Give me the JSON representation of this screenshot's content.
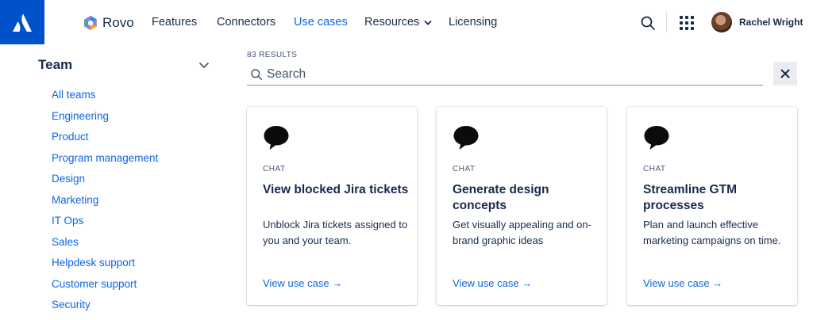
{
  "header": {
    "product_name": "Rovo",
    "nav": [
      {
        "label": "Features"
      },
      {
        "label": "Connectors"
      },
      {
        "label": "Use cases",
        "active": true
      },
      {
        "label": "Resources",
        "has_dropdown": true
      },
      {
        "label": "Licensing"
      }
    ],
    "user_name": "Rachel Wright",
    "icons": [
      "atlassian-logo-icon",
      "rovo-logo-icon",
      "search-icon",
      "app-switcher-icon",
      "avatar"
    ]
  },
  "sidebar": {
    "title": "Team",
    "items": [
      {
        "label": "All teams"
      },
      {
        "label": "Engineering"
      },
      {
        "label": "Product"
      },
      {
        "label": "Program management"
      },
      {
        "label": "Design"
      },
      {
        "label": "Marketing"
      },
      {
        "label": "IT Ops"
      },
      {
        "label": "Sales"
      },
      {
        "label": "Helpdesk support"
      },
      {
        "label": "Customer support"
      },
      {
        "label": "Security"
      }
    ]
  },
  "results": {
    "count_label": "83 RESULTS"
  },
  "search": {
    "placeholder": "Search",
    "value": ""
  },
  "cards": [
    {
      "category": "CHAT",
      "title": "View blocked Jira tickets",
      "description": "Unblock Jira tickets assigned to you and your team.",
      "link": "View use case →"
    },
    {
      "category": "CHAT",
      "title": "Generate design concepts",
      "description": "Get visually appealing and on-brand graphic ideas",
      "link": "View use case →"
    },
    {
      "category": "CHAT",
      "title": "Streamline GTM processes",
      "description": "Plan and launch effective marketing campaigns on time.",
      "link": "View use case →"
    }
  ],
  "colors": {
    "brand_blue": "#0052CC",
    "link_blue": "#0C66E4",
    "text": "#172B4D"
  }
}
